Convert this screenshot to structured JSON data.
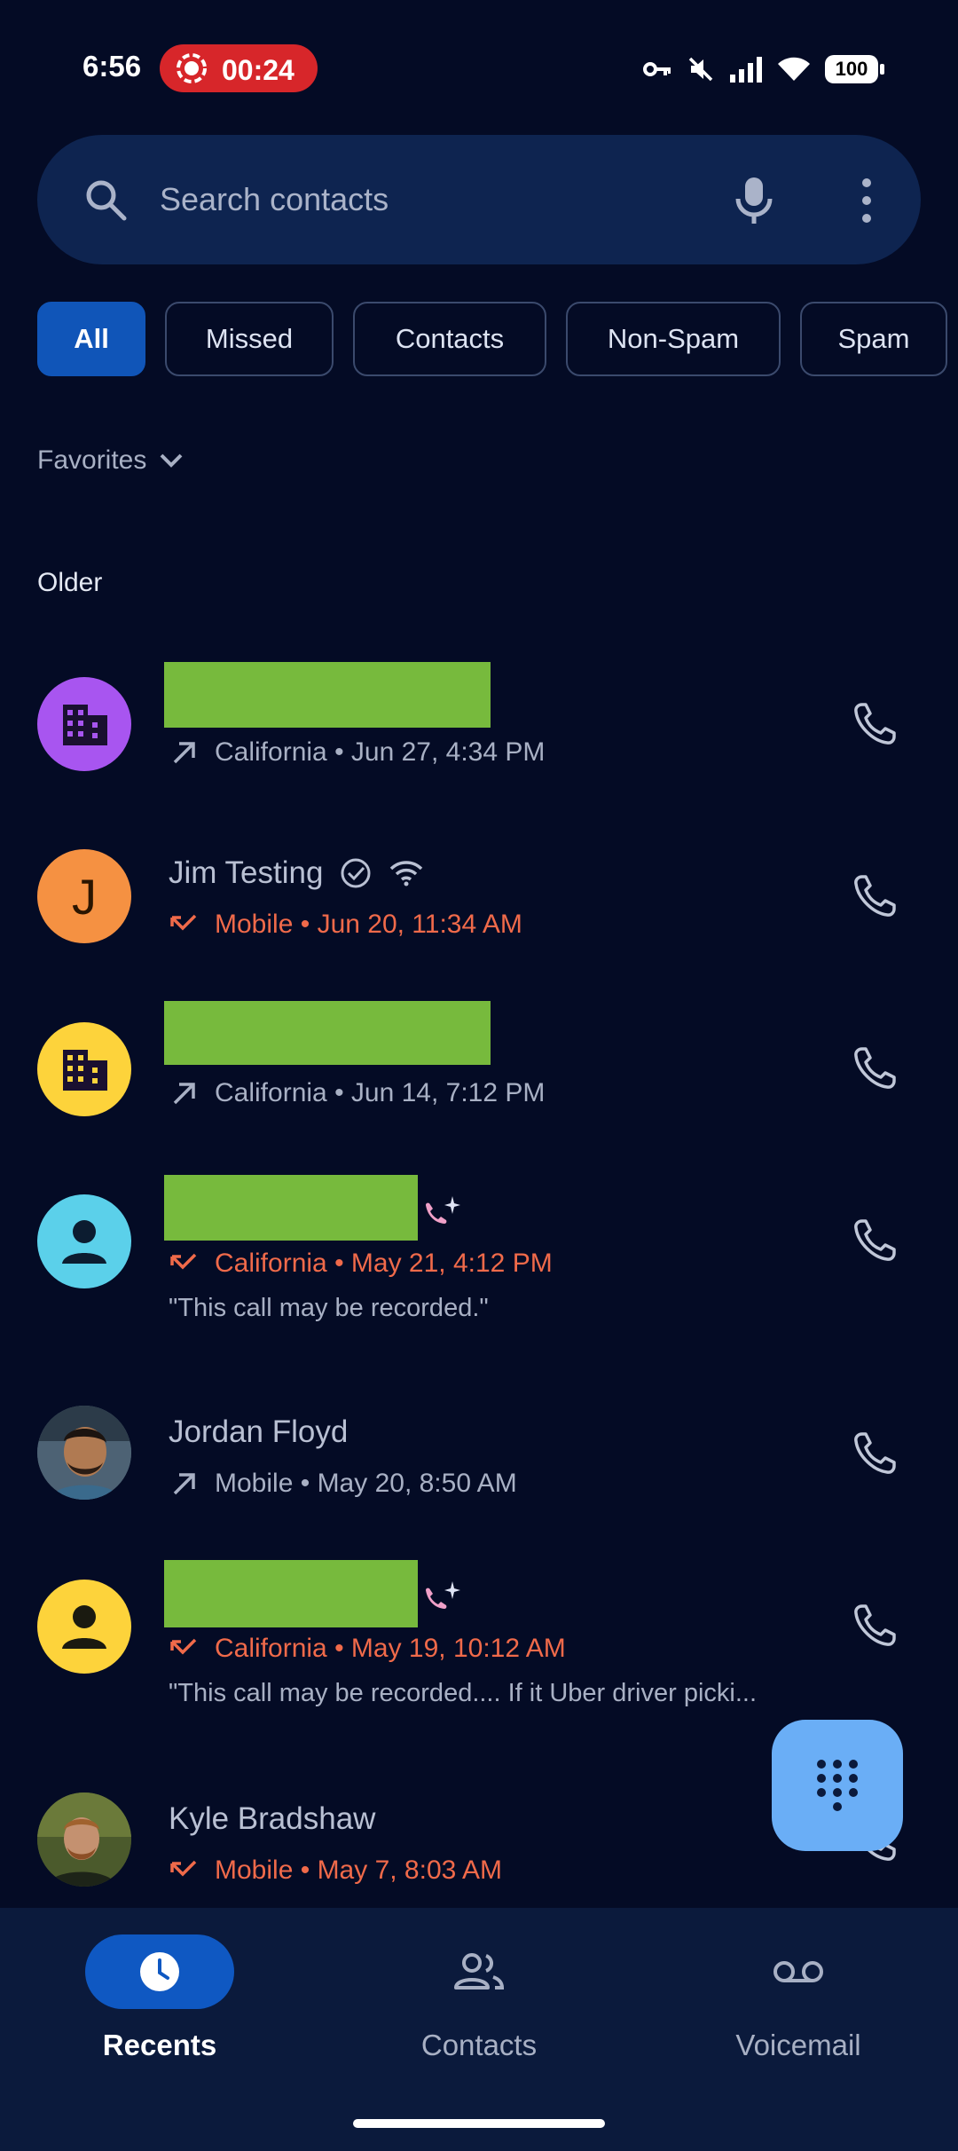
{
  "status_bar": {
    "time": "6:56",
    "recording_timer": "00:24",
    "battery": "100"
  },
  "search": {
    "placeholder": "Search contacts"
  },
  "filters": [
    "All",
    "Missed",
    "Contacts",
    "Non-Spam",
    "Spam"
  ],
  "filter_selected": "All",
  "favorites_label": "Favorites",
  "section_label": "Older",
  "calls": [
    {
      "name": "",
      "redacted": true,
      "avatar": "business-icon",
      "avatar_color": "#a855f0",
      "direction": "outgoing",
      "location": "California",
      "time": "Jun 27, 4:34 PM",
      "transcript": ""
    },
    {
      "name": "Jim Testing",
      "redacted": false,
      "avatar": "J",
      "avatar_color": "#f59142",
      "direction": "missed",
      "location": "Mobile",
      "time": "Jun 20, 11:34 AM",
      "transcript": "",
      "verified": true,
      "wifi_call": true
    },
    {
      "name": "",
      "redacted": true,
      "avatar": "business-icon",
      "avatar_color": "#fdd33b",
      "direction": "outgoing",
      "location": "California",
      "time": "Jun 14, 7:12 PM",
      "transcript": ""
    },
    {
      "name": "",
      "redacted": true,
      "avatar": "person-icon",
      "avatar_color": "#5bd0ea",
      "direction": "missed",
      "location": "California",
      "time": "May 21, 4:12 PM",
      "transcript": "\"This call may be recorded.\"",
      "call_screen": true
    },
    {
      "name": "Jordan Floyd",
      "redacted": false,
      "avatar": "photo",
      "avatar_color": "#3a4a5a",
      "direction": "outgoing",
      "location": "Mobile",
      "time": "May 20, 8:50 AM",
      "transcript": ""
    },
    {
      "name": "",
      "redacted": true,
      "avatar": "person-icon",
      "avatar_color": "#fdd33b",
      "direction": "missed",
      "location": "California",
      "time": "May 19, 10:12 AM",
      "transcript": "\"This call may be recorded.... If it Uber driver picki...",
      "call_screen": true
    },
    {
      "name": "Kyle Bradshaw",
      "redacted": false,
      "avatar": "photo",
      "avatar_color": "#2d3a24",
      "direction": "missed",
      "location": "Mobile",
      "time": "May 7, 8:03 AM",
      "transcript": ""
    }
  ],
  "nav": {
    "recents": "Recents",
    "contacts": "Contacts",
    "voicemail": "Voicemail",
    "active": "Recents"
  },
  "colors": {
    "background": "#040b25",
    "accent": "#1055b8",
    "missed": "#f06a4a",
    "fab": "#6aaef6"
  }
}
